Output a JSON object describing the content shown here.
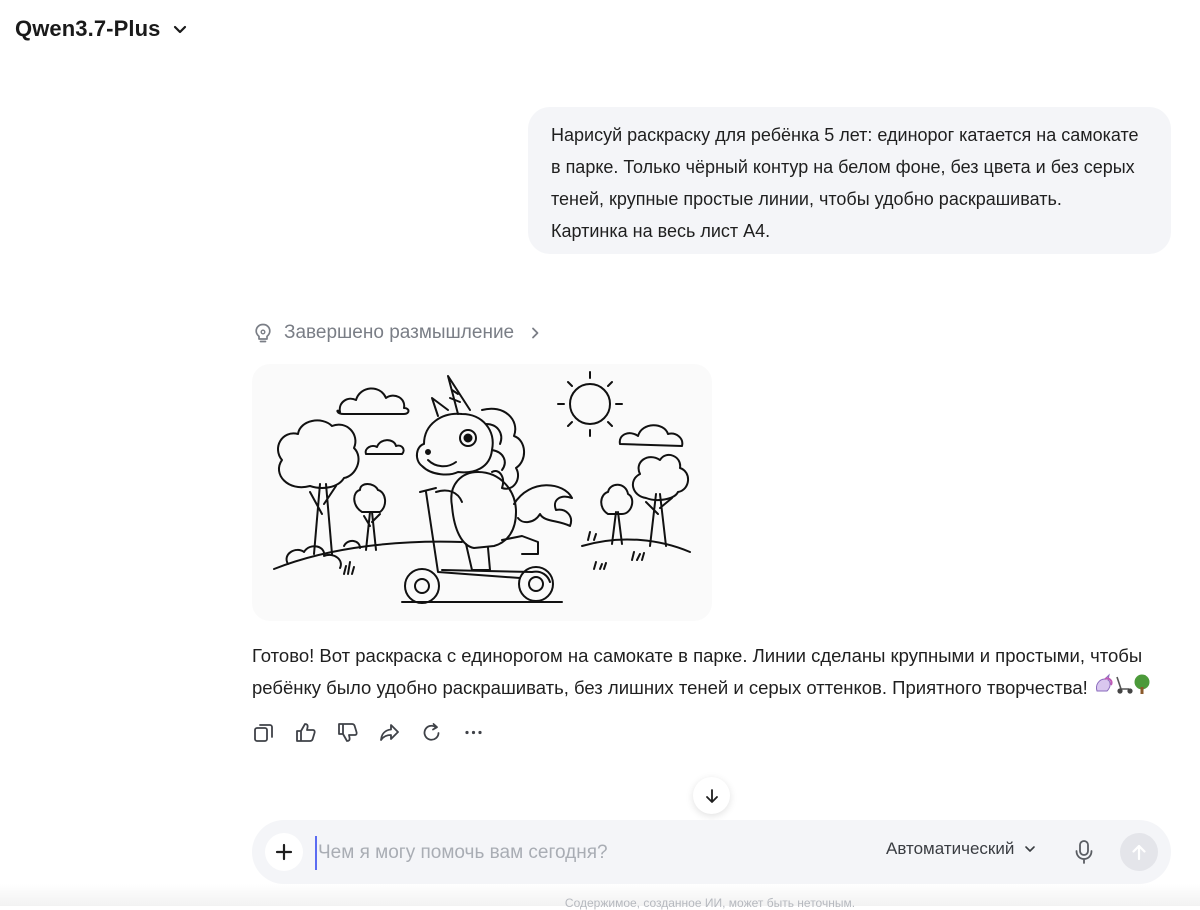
{
  "header": {
    "model_name": "Qwen3.7-Plus",
    "icon": "chevron-down-icon"
  },
  "user_message": {
    "lines": [
      "Нарисуй раскраску для ребёнка 5 лет: единорог катается на самокате",
      "в парке. Только чёрный контур на белом фоне, без цвета и без серых",
      "теней, крупные простые линии, чтобы удобно раскрашивать.",
      "Картинка на весь лист А4."
    ]
  },
  "thinking": {
    "label": "Завершено размышление",
    "icon": "lightbulb-icon"
  },
  "image": {
    "alt": "unicorn-scooter-coloring-page"
  },
  "answer": {
    "lines": [
      "Готово! Вот раскраска с единорогом на самокате в парке. Линии сделаны крупными и простыми, чтобы",
      "ребёнку было удобно раскрашивать, без лишних теней и серых оттенков. Приятного творчества!"
    ],
    "emojis": [
      "unicorn-emoji",
      "scooter-emoji",
      "tree-emoji"
    ]
  },
  "actions": [
    "copy-icon",
    "thumbs-up-icon",
    "thumbs-down-icon",
    "share-icon",
    "regenerate-icon",
    "more-icon"
  ],
  "composer": {
    "placeholder": "Чем я могу помочь вам сегодня?",
    "value": "",
    "mode_label": "Автоматический"
  },
  "footer": {
    "disclaimer": "Содержимое, созданное ИИ, может быть неточным."
  }
}
